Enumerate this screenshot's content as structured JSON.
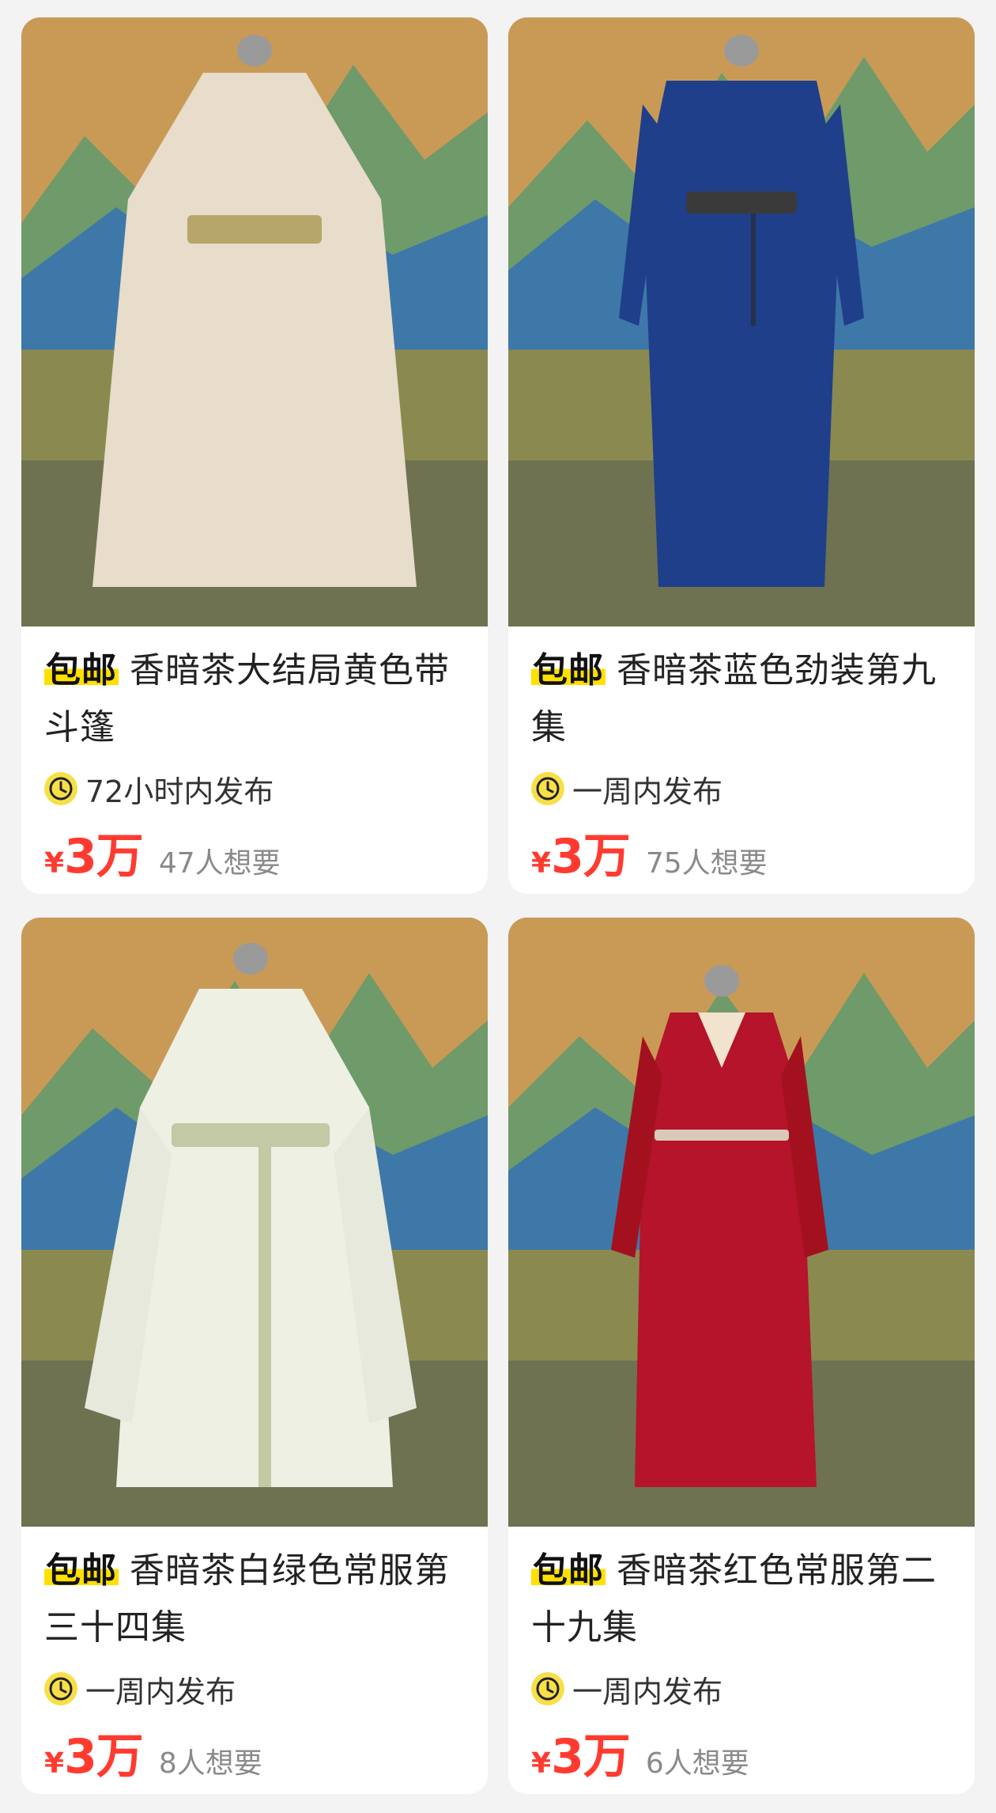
{
  "colors": {
    "accent_price": "#ff3b30",
    "badge_highlight": "#ffe000",
    "clock_badge": "#f7df48",
    "page_background": "#f3f3f4"
  },
  "products": [
    {
      "badge": "包邮",
      "title": "香暗茶大结局黄色带斗篷",
      "time_icon": "clock-icon",
      "time_text": "72小时内发布",
      "currency": "¥",
      "price": "3万",
      "wants": "47人想要",
      "image_subject": "cream robe on mannequin",
      "robe_color": "#e8dccb"
    },
    {
      "badge": "包邮",
      "title": "香暗茶蓝色劲装第九集",
      "time_icon": "clock-icon",
      "time_text": "一周内发布",
      "currency": "¥",
      "price": "3万",
      "wants": "75人想要",
      "image_subject": "blue robe on mannequin",
      "robe_color": "#1f3f8a"
    },
    {
      "badge": "包邮",
      "title": "香暗茶白绿色常服第三十四集",
      "time_icon": "clock-icon",
      "time_text": "一周内发布",
      "currency": "¥",
      "price": "3万",
      "wants": "8人想要",
      "image_subject": "white-green robe on mannequin",
      "robe_color": "#eef0e4"
    },
    {
      "badge": "包邮",
      "title": "香暗茶红色常服第二十九集",
      "time_icon": "clock-icon",
      "time_text": "一周内发布",
      "currency": "¥",
      "price": "3万",
      "wants": "6人想要",
      "image_subject": "red robe on mannequin",
      "robe_color": "#b5142a"
    }
  ]
}
